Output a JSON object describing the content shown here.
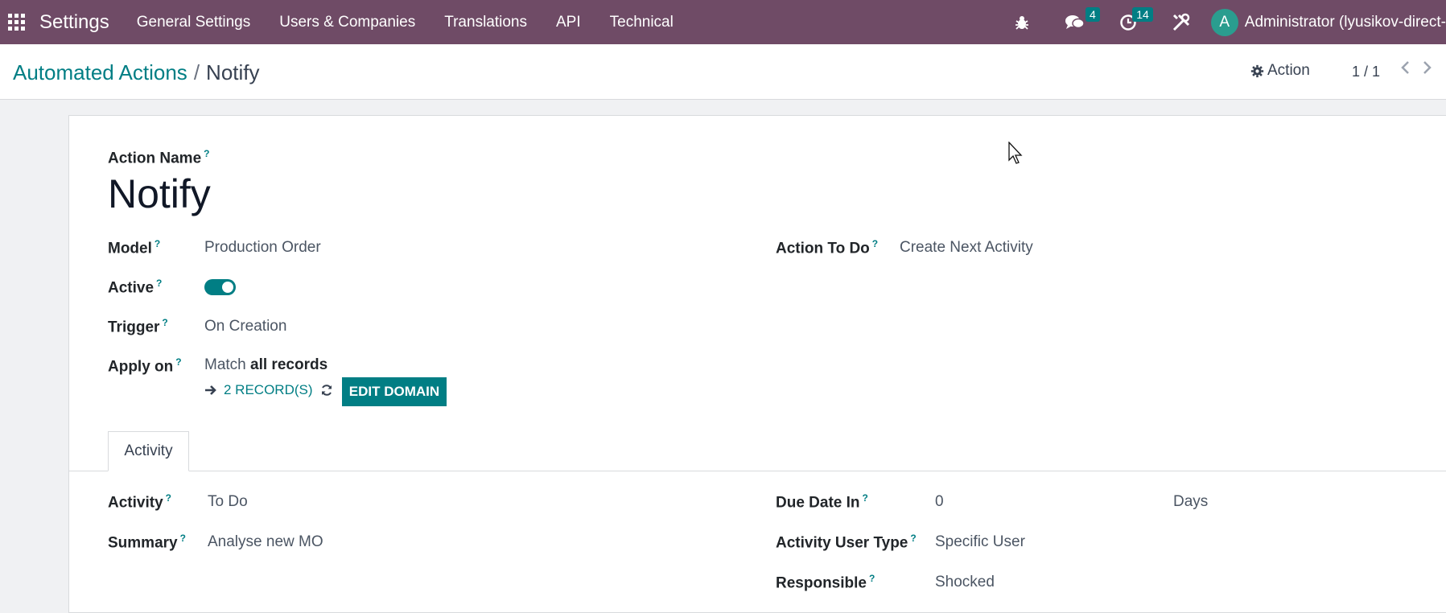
{
  "navbar": {
    "brand": "Settings",
    "menu": [
      "General Settings",
      "Users & Companies",
      "Translations",
      "API",
      "Technical"
    ],
    "messages_count": "4",
    "activities_count": "14",
    "avatar_letter": "A",
    "user": "Administrator (lyusikov-direct-"
  },
  "control_panel": {
    "breadcrumb_parent": "Automated Actions",
    "breadcrumb_separator": "/",
    "breadcrumb_current": "Notify",
    "action_label": "Action",
    "pager": "1 / 1"
  },
  "form": {
    "action_name_label": "Action Name",
    "action_name": "Notify",
    "model_label": "Model",
    "model": "Production Order",
    "active_label": "Active",
    "active": true,
    "trigger_label": "Trigger",
    "trigger": "On Creation",
    "apply_on_label": "Apply on",
    "apply_on_prefix": "Match",
    "apply_on_bold": "all records",
    "records_link": "2 RECORD(S)",
    "edit_domain": "EDIT DOMAIN",
    "action_to_do_label": "Action To Do",
    "action_to_do": "Create Next Activity",
    "help_mark": "?"
  },
  "tabs": [
    "Activity"
  ],
  "activity": {
    "activity_label": "Activity",
    "activity": "To Do",
    "summary_label": "Summary",
    "summary": "Analyse new MO",
    "due_date_label": "Due Date In",
    "due_date_value": "0",
    "due_date_unit": "Days",
    "user_type_label": "Activity User Type",
    "user_type": "Specific User",
    "responsible_label": "Responsible",
    "responsible": "Shocked"
  },
  "colors": {
    "navbar": "#6f4b66",
    "accent": "#017e84"
  }
}
